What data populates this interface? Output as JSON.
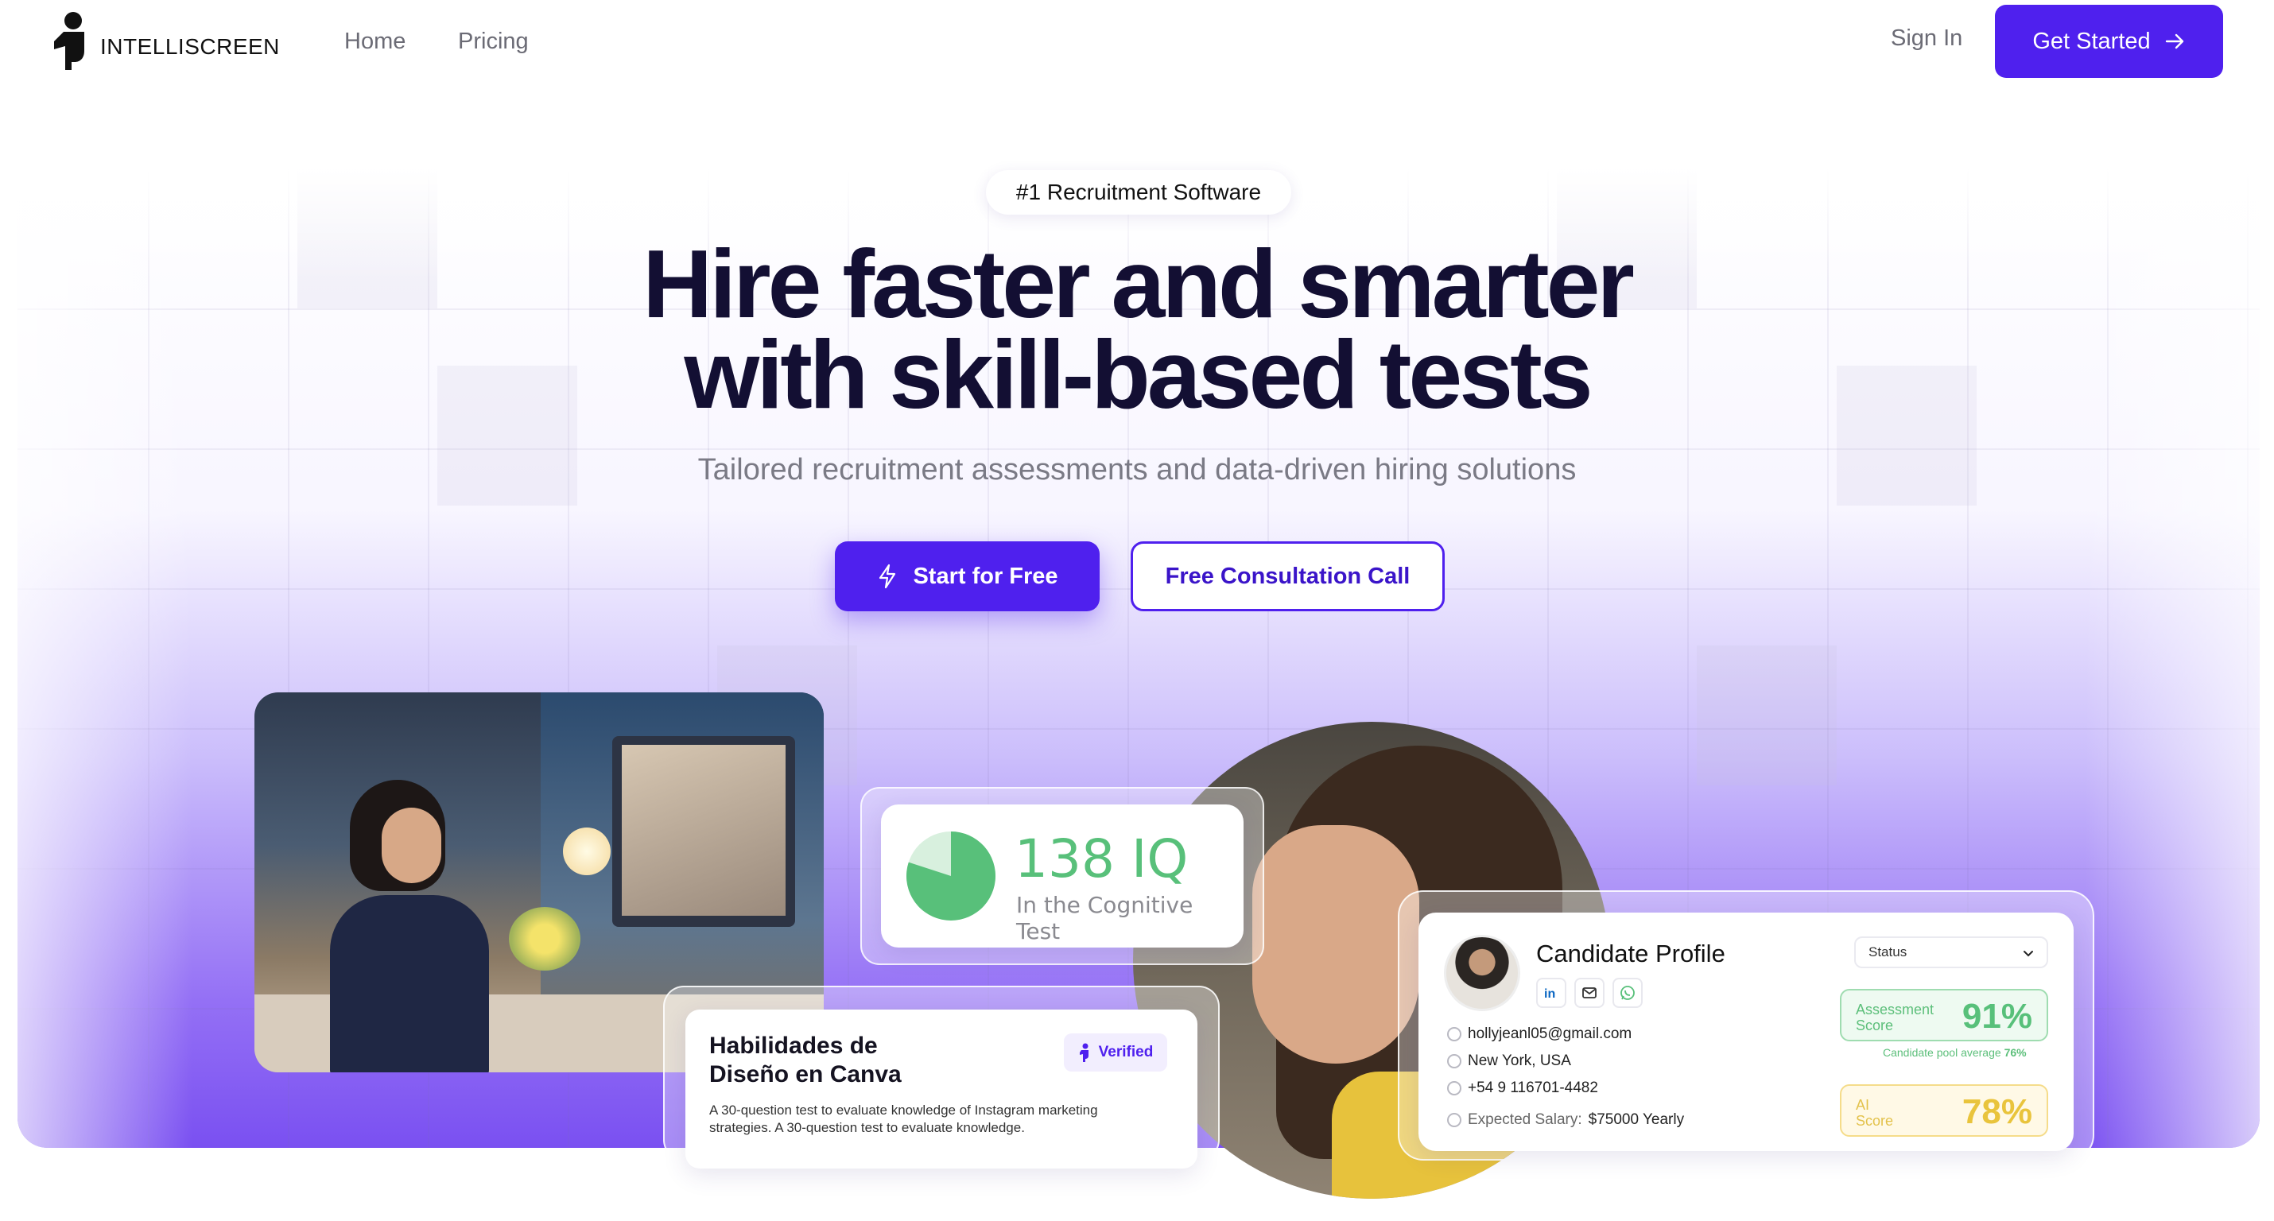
{
  "nav": {
    "brand": "INTELLISCREEN",
    "links": [
      "Home",
      "Pricing"
    ],
    "sign_in": "Sign In",
    "get_started": "Get Started"
  },
  "hero": {
    "badge": "#1 Recruitment Software",
    "title_line1": "Hire faster and smarter",
    "title_line2": "with skill-based tests",
    "subtitle": "Tailored recruitment assessments and data-driven hiring solutions",
    "primary_cta": "Start for Free",
    "secondary_cta": "Free Consultation Call"
  },
  "iq_card": {
    "value": "138 IQ",
    "caption": "In the Cognitive Test",
    "pie_fill_fraction": 0.8
  },
  "test_card": {
    "title_line1": "Habilidades de",
    "title_line2": "Diseño en Canva",
    "badge": "Verified",
    "description": "A 30-question test to evaluate knowledge of Instagram marketing strategies. A 30-question test to evaluate knowledge."
  },
  "candidate_card": {
    "title": "Candidate Profile",
    "status_placeholder": "Status",
    "email": "hollyjeanl05@gmail.com",
    "location": "New York, USA",
    "phone": "+54 9 116701-4482",
    "salary_label": "Expected Salary:",
    "salary_value": "$75000 Yearly",
    "assessment_label_1": "Assessment",
    "assessment_label_2": "Score",
    "assessment_value": "91%",
    "pool_avg_label": "Candidate pool average",
    "pool_avg_value": "76%",
    "ai_label_1": "AI",
    "ai_label_2": "Score",
    "ai_value": "78%"
  },
  "colors": {
    "brand": "#4f20ee",
    "score_green": "#58c07a",
    "score_yellow": "#e9c43c",
    "heading": "#130f33"
  },
  "icons": [
    "person-logo-icon",
    "arrow-right-icon",
    "lightning-icon",
    "pie-chart-icon",
    "verified-logo-icon",
    "linkedin-icon",
    "mail-icon",
    "whatsapp-icon",
    "chevron-down-icon"
  ]
}
